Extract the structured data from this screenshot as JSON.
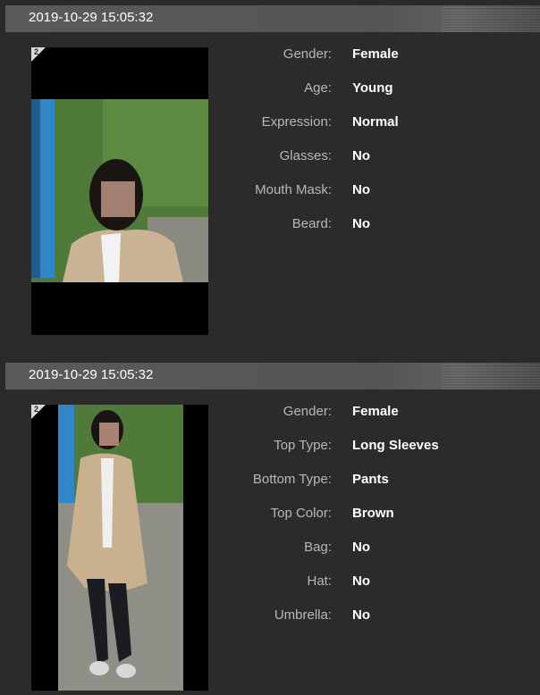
{
  "records": [
    {
      "timestamp": "2019-10-29 15:05:32",
      "badge": "2",
      "attributes": [
        {
          "label": "Gender:",
          "value": "Female"
        },
        {
          "label": "Age:",
          "value": "Young"
        },
        {
          "label": "Expression:",
          "value": "Normal"
        },
        {
          "label": "Glasses:",
          "value": "No"
        },
        {
          "label": "Mouth Mask:",
          "value": "No"
        },
        {
          "label": "Beard:",
          "value": "No"
        }
      ]
    },
    {
      "timestamp": "2019-10-29 15:05:32",
      "badge": "2",
      "attributes": [
        {
          "label": "Gender:",
          "value": "Female"
        },
        {
          "label": "Top Type:",
          "value": "Long Sleeves"
        },
        {
          "label": "Bottom Type:",
          "value": "Pants"
        },
        {
          "label": "Top Color:",
          "value": "Brown"
        },
        {
          "label": "Bag:",
          "value": "No"
        },
        {
          "label": "Hat:",
          "value": "No"
        },
        {
          "label": "Umbrella:",
          "value": "No"
        }
      ]
    }
  ]
}
